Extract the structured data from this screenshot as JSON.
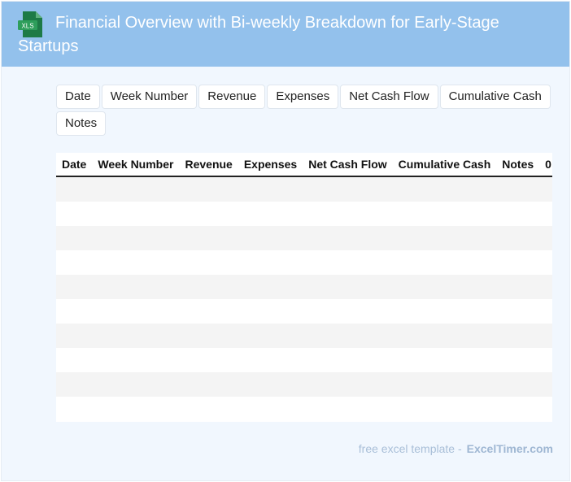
{
  "header": {
    "title": "Financial Overview with Bi-weekly Breakdown for Early-Stage Startups",
    "icon": "xls-file-icon",
    "icon_label": "XLS",
    "background": "#93c1ec"
  },
  "chips": [
    "Date",
    "Week Number",
    "Revenue",
    "Expenses",
    "Net Cash Flow",
    "Cumulative Cash",
    "Notes"
  ],
  "table": {
    "columns": [
      "Date",
      "Week Number",
      "Revenue",
      "Expenses",
      "Net Cash Flow",
      "Cumulative Cash",
      "Notes",
      "0"
    ],
    "row_count": 10
  },
  "footer": {
    "prefix": "free excel template -",
    "brand": "ExcelTimer.com"
  }
}
